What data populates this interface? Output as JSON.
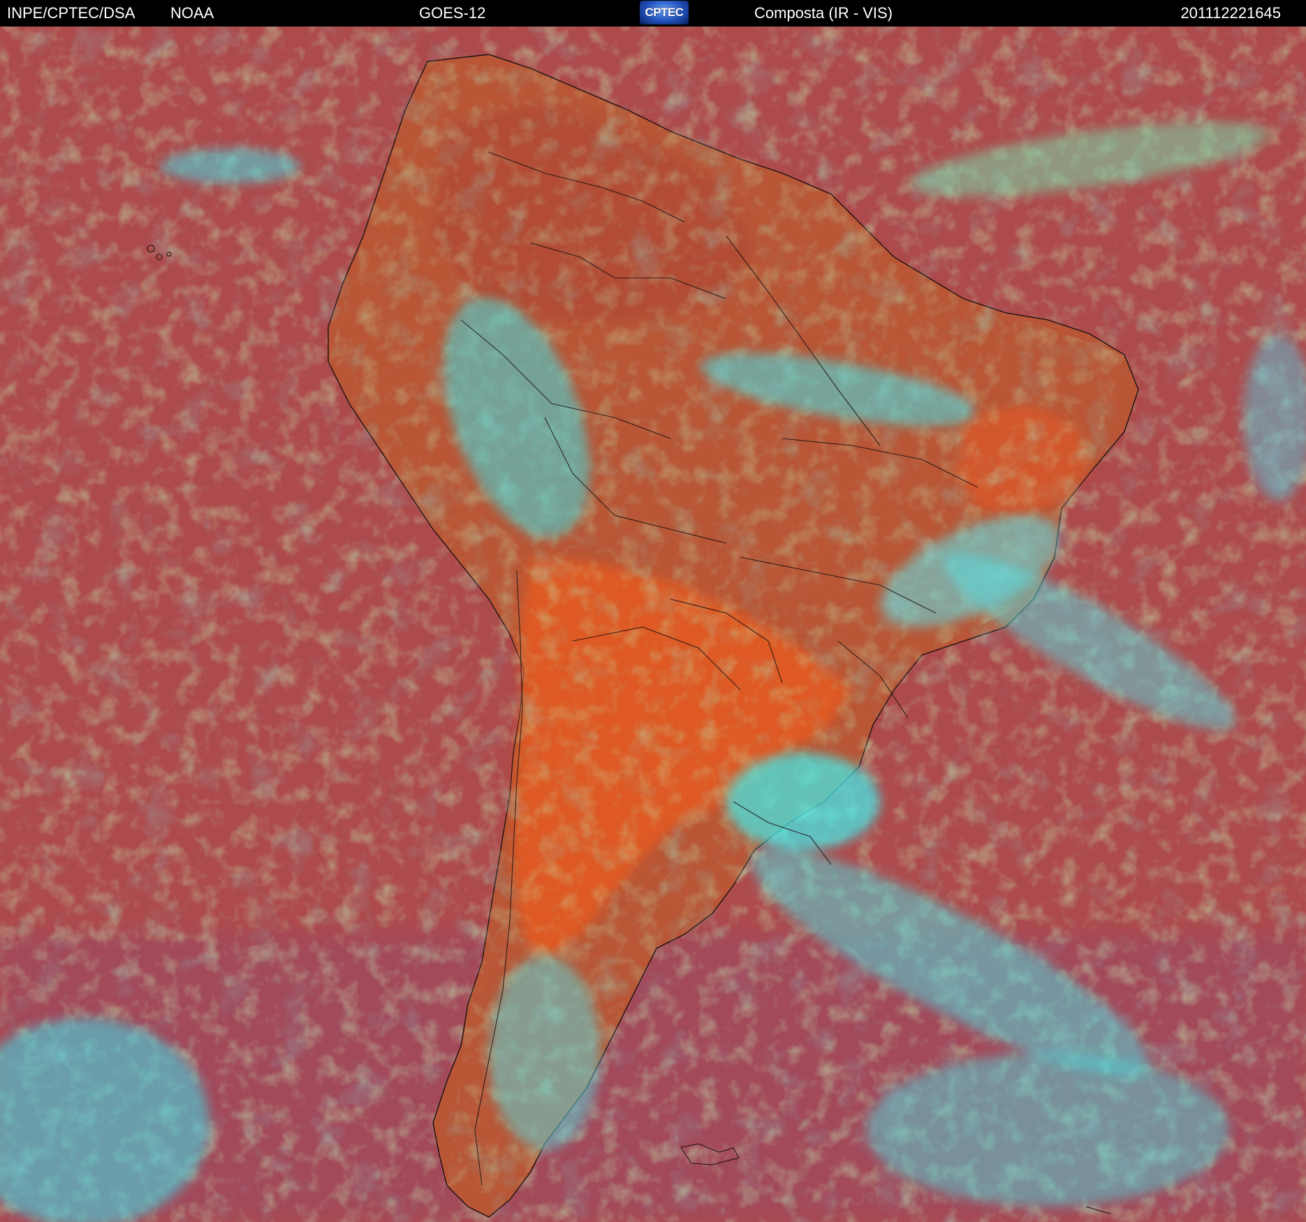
{
  "header": {
    "source": "INPE/CPTEC/DSA",
    "agency": "NOAA",
    "satellite": "GOES-12",
    "logo_text": "CPTEC",
    "product": "Composta (IR - VIS)",
    "timestamp": "201112221645"
  },
  "colors": {
    "ocean": "#b04848",
    "land_dry": "#c8582e",
    "land_hot": "#e65a20",
    "cloud_low": "#7fd86a",
    "cloud_high": "#40e8e8",
    "borders": "#1a1010",
    "header_bg": "#000000",
    "header_text": "#ffffff"
  }
}
